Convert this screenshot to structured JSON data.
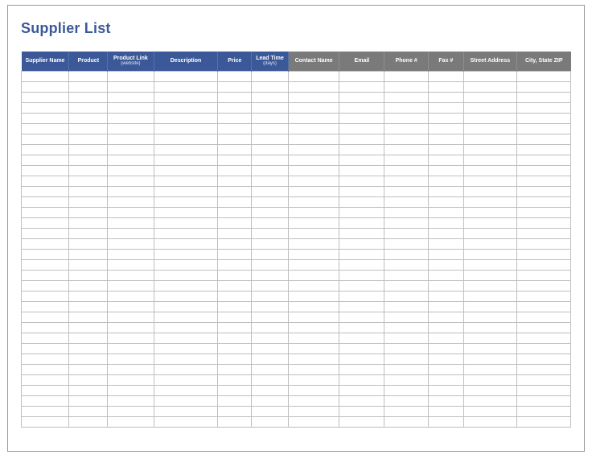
{
  "title": "Supplier List",
  "columns": [
    {
      "label": "Supplier Name",
      "sub": "",
      "group": "blue"
    },
    {
      "label": "Product",
      "sub": "",
      "group": "blue"
    },
    {
      "label": "Product Link",
      "sub": "(website)",
      "group": "blue"
    },
    {
      "label": "Description",
      "sub": "",
      "group": "blue"
    },
    {
      "label": "Price",
      "sub": "",
      "group": "blue"
    },
    {
      "label": "Lead Time",
      "sub": "(days)",
      "group": "blue"
    },
    {
      "label": "Contact Name",
      "sub": "",
      "group": "grey"
    },
    {
      "label": "Email",
      "sub": "",
      "group": "grey"
    },
    {
      "label": "Phone #",
      "sub": "",
      "group": "grey"
    },
    {
      "label": "Fax #",
      "sub": "",
      "group": "grey"
    },
    {
      "label": "Street Address",
      "sub": "",
      "group": "grey"
    },
    {
      "label": "City, State  ZIP",
      "sub": "",
      "group": "grey"
    }
  ],
  "row_count": 34
}
